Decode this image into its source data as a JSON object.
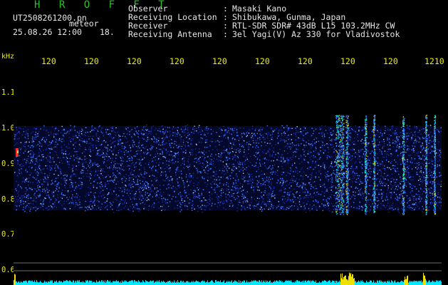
{
  "header": {
    "brand": "H R O F F T",
    "filename": "UT2508261200.pn",
    "product": "meteor",
    "date_time": "25.08.26 12:00",
    "minute": "18.",
    "meta": [
      {
        "label": "Observer",
        "value": "Masaki Kano"
      },
      {
        "label": "Receiving Location",
        "value": "Shibukawa, Gunma, Japan"
      },
      {
        "label": "Receiver",
        "value": "RTL-SDR SDR# 43dB L15 103.2MHz CW"
      },
      {
        "label": "Receiving Antenna",
        "value": "3el Yagi(V) Az 330 for Vladivostok"
      }
    ]
  },
  "spectrogram": {
    "unit": "kHz",
    "x_ticks": [
      "120",
      "120",
      "120",
      "120",
      "120",
      "120",
      "120",
      "120",
      "120",
      "1210"
    ],
    "y_ticks": [
      "1.1",
      "1.0",
      "0.9",
      "0.8",
      "0.7",
      "0.6"
    ],
    "colors": {
      "background": "#000000",
      "noise_low": "#1a2aa8",
      "noise_high": "#3a7cff",
      "echo": "#00ffd8",
      "hot": "#ff2a2a",
      "tick": "#f0f000",
      "grid": "#6c6c6c",
      "baseline": "#00e8ff"
    }
  }
}
